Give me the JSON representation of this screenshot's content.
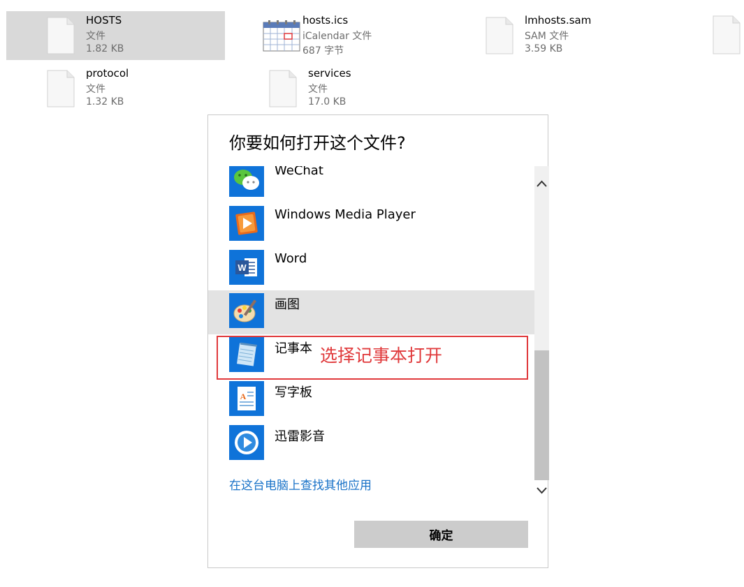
{
  "files": [
    {
      "name": "HOSTS",
      "type": "文件",
      "size": "1.82 KB",
      "icon": "blank-file-icon",
      "selected": true
    },
    {
      "name": "hosts.ics",
      "type": "iCalendar 文件",
      "size": "687 字节",
      "icon": "calendar-file-icon",
      "selected": false
    },
    {
      "name": "lmhosts.sam",
      "type": "SAM 文件",
      "size": "3.59 KB",
      "icon": "blank-file-icon",
      "selected": false
    },
    {
      "name": "protocol",
      "type": "文件",
      "size": "1.32 KB",
      "icon": "blank-file-icon",
      "selected": false
    },
    {
      "name": "services",
      "type": "文件",
      "size": "17.0 KB",
      "icon": "blank-file-icon",
      "selected": false
    }
  ],
  "dialog": {
    "title": "你要如何打开这个文件?",
    "apps": [
      {
        "label": "WeChat",
        "icon": "wechat-icon",
        "state": "partial"
      },
      {
        "label": "Windows Media Player",
        "icon": "windows-media-player-icon",
        "state": "normal"
      },
      {
        "label": "Word",
        "icon": "word-icon",
        "state": "normal"
      },
      {
        "label": "画图",
        "icon": "paint-icon",
        "state": "hover"
      },
      {
        "label": "记事本",
        "icon": "notepad-icon",
        "state": "normal"
      },
      {
        "label": "写字板",
        "icon": "wordpad-icon",
        "state": "normal"
      },
      {
        "label": "迅雷影音",
        "icon": "xunlei-player-icon",
        "state": "normal"
      }
    ],
    "more_link": "在这台电脑上查找其他应用",
    "ok_label": "确定"
  },
  "annotation": {
    "text": "选择记事本打开",
    "color": "#e0393b"
  },
  "colors": {
    "selected_file_bg": "#d9d9d9",
    "hover_item_bg": "#e3e3e3",
    "link": "#1a73c8",
    "icon_blue": "#0f73d9",
    "button_bg": "#cccccc"
  }
}
